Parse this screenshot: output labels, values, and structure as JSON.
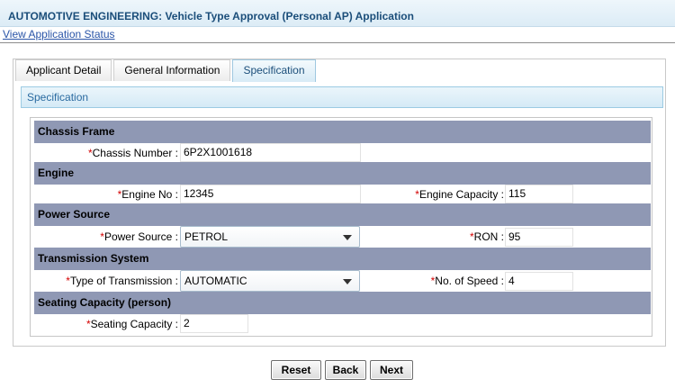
{
  "header": {
    "title": "AUTOMOTIVE ENGINEERING: Vehicle Type Approval (Personal AP) Application",
    "status_link": "View Application Status"
  },
  "tabs": [
    {
      "label": "Applicant Detail"
    },
    {
      "label": "General Information"
    },
    {
      "label": "Specification",
      "active": true
    }
  ],
  "section": {
    "title": "Specification"
  },
  "required_mark": "*",
  "groups": {
    "chassis": {
      "title": "Chassis Frame",
      "chassis_number": {
        "label": "Chassis Number :",
        "value": "6P2X1001618"
      }
    },
    "engine": {
      "title": "Engine",
      "engine_no": {
        "label": "Engine No :",
        "value": "12345"
      },
      "engine_capacity": {
        "label": "Engine Capacity :",
        "value": "115"
      }
    },
    "power": {
      "title": "Power Source",
      "power_source": {
        "label": "Power Source :",
        "value": "PETROL"
      },
      "ron": {
        "label": "RON :",
        "value": "95"
      }
    },
    "transmission": {
      "title": "Transmission System",
      "type": {
        "label": "Type of Transmission :",
        "value": "AUTOMATIC"
      },
      "speeds": {
        "label": "No. of Speed :",
        "value": "4"
      }
    },
    "seating": {
      "title": "Seating Capacity (person)",
      "capacity": {
        "label": "Seating Capacity :",
        "value": "2"
      }
    }
  },
  "buttons": {
    "reset": "Reset",
    "back": "Back",
    "next": "Next"
  },
  "colors": {
    "group_header_bg": "#8f98b4",
    "required": "#d40000",
    "link": "#2a55a8"
  }
}
